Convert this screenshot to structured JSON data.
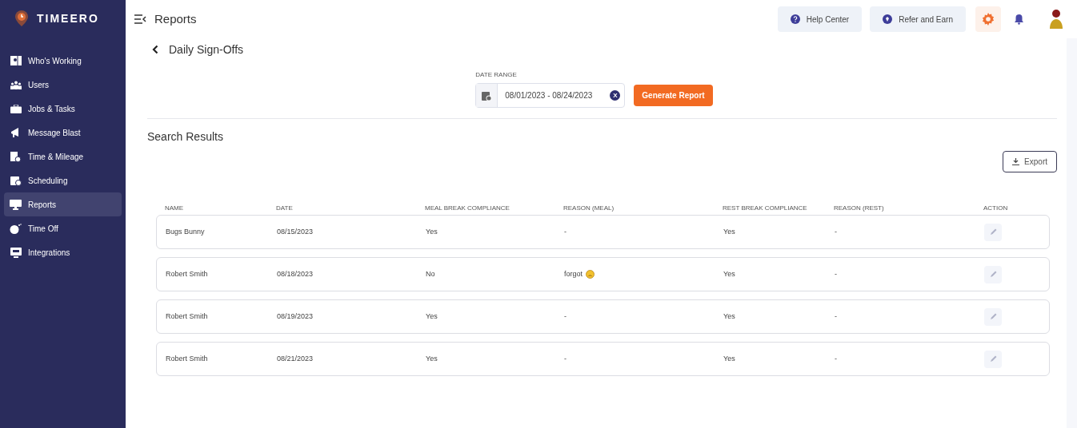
{
  "sidebar": {
    "logo": "TIMEERO",
    "items": [
      {
        "label": "Who's Working",
        "selected": false
      },
      {
        "label": "Users",
        "selected": false
      },
      {
        "label": "Jobs & Tasks",
        "selected": false
      },
      {
        "label": "Message Blast",
        "selected": false
      },
      {
        "label": "Time & Mileage",
        "selected": false
      },
      {
        "label": "Scheduling",
        "selected": false
      },
      {
        "label": "Reports",
        "selected": true
      },
      {
        "label": "Time Off",
        "selected": false
      },
      {
        "label": "Integrations",
        "selected": false
      }
    ]
  },
  "topbar": {
    "title": "Reports",
    "buttons": [
      "Help Center",
      "Refer and Earn"
    ]
  },
  "page": {
    "title": "Daily Sign-Offs",
    "date_range": {
      "label": "DATE RANGE",
      "value": "08/01/2023 - 08/24/2023",
      "clear": "X"
    },
    "generate_button": "Generate Report",
    "results_title": "Search Results",
    "export_button": "Export"
  },
  "table": {
    "columns": [
      "NAME",
      "DATE",
      "MEAL BREAK COMPLIANCE",
      "REASON (MEAL)",
      "REST BREAK COMPLIANCE",
      "REASON (REST)",
      "ACTION"
    ],
    "rows": [
      {
        "name": "Bugs Bunny",
        "date": "08/15/2023",
        "meal": "Yes",
        "meal_reason": "-",
        "meal_emoji": false,
        "rest": "Yes",
        "rest_reason": "-"
      },
      {
        "name": "Robert Smith",
        "date": "08/18/2023",
        "meal": "No",
        "meal_reason": "forgot",
        "meal_emoji": true,
        "rest": "Yes",
        "rest_reason": "-"
      },
      {
        "name": "Robert Smith",
        "date": "08/19/2023",
        "meal": "Yes",
        "meal_reason": "-",
        "meal_emoji": false,
        "rest": "Yes",
        "rest_reason": "-"
      },
      {
        "name": "Robert Smith",
        "date": "08/21/2023",
        "meal": "Yes",
        "meal_reason": "-",
        "meal_emoji": false,
        "rest": "Yes",
        "rest_reason": "-"
      }
    ]
  }
}
